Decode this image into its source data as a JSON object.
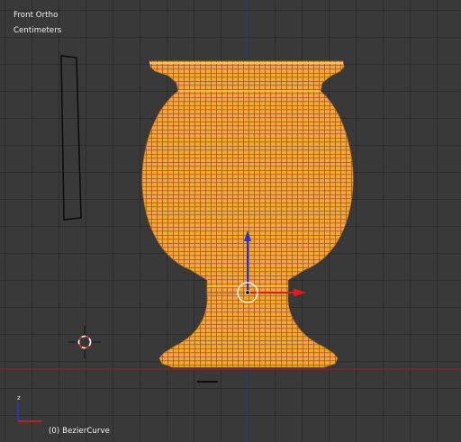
{
  "viewport": {
    "view_name": "Front Ortho",
    "units": "Centimeters",
    "active_object_label": "(0) BezierCurve"
  },
  "axis_gizmo": {
    "up_axis_label": "z"
  },
  "colors": {
    "background": "#393939",
    "mesh_fill": "#f7a43a",
    "mesh_wire": "#8a4e14",
    "axis_x": "#a82020",
    "axis_z": "#233c9a",
    "gizmo_x": "#e21c1c",
    "gizmo_z": "#2233e0"
  },
  "scene_objects": {
    "selected_mesh": "goblet-mesh",
    "profile_curve": "bezier-profile-curve",
    "cursor": "3d-cursor-icon"
  }
}
